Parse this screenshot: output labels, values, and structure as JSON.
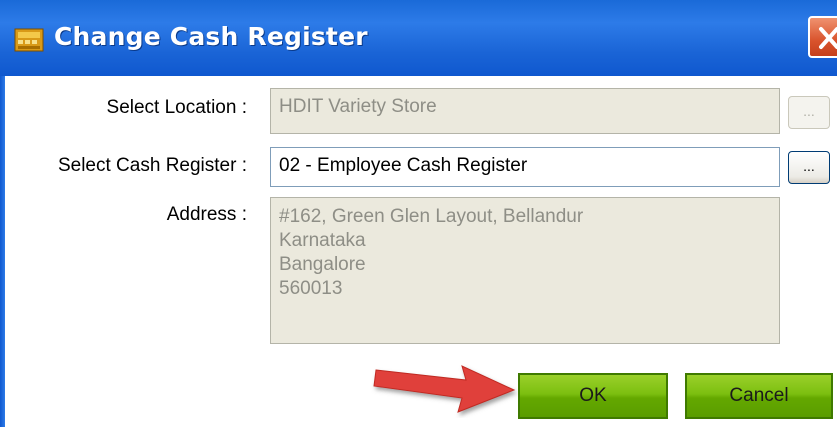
{
  "window": {
    "title": "Change Cash Register",
    "icons": {
      "title_icon": "cash-register-icon",
      "close_icon": "close-icon",
      "annotation": "red-arrow-icon"
    },
    "colors": {
      "titlebar": "#1a64d6",
      "button_green": "#64a800",
      "close_red": "#d9532c",
      "arrow_red": "#e0403a"
    }
  },
  "form": {
    "location": {
      "label": "Select Location :",
      "value": "HDIT Variety Store",
      "browse_label": "...",
      "enabled": false
    },
    "cash_register": {
      "label": "Select Cash Register :",
      "value": "02 - Employee Cash Register",
      "browse_label": "...",
      "enabled": true
    },
    "address": {
      "label": "Address :",
      "lines": [
        "#162, Green Glen Layout, Bellandur",
        "",
        "Karnataka",
        "Bangalore",
        "560013"
      ],
      "enabled": false
    }
  },
  "buttons": {
    "ok_label": "OK",
    "cancel_label": "Cancel"
  }
}
